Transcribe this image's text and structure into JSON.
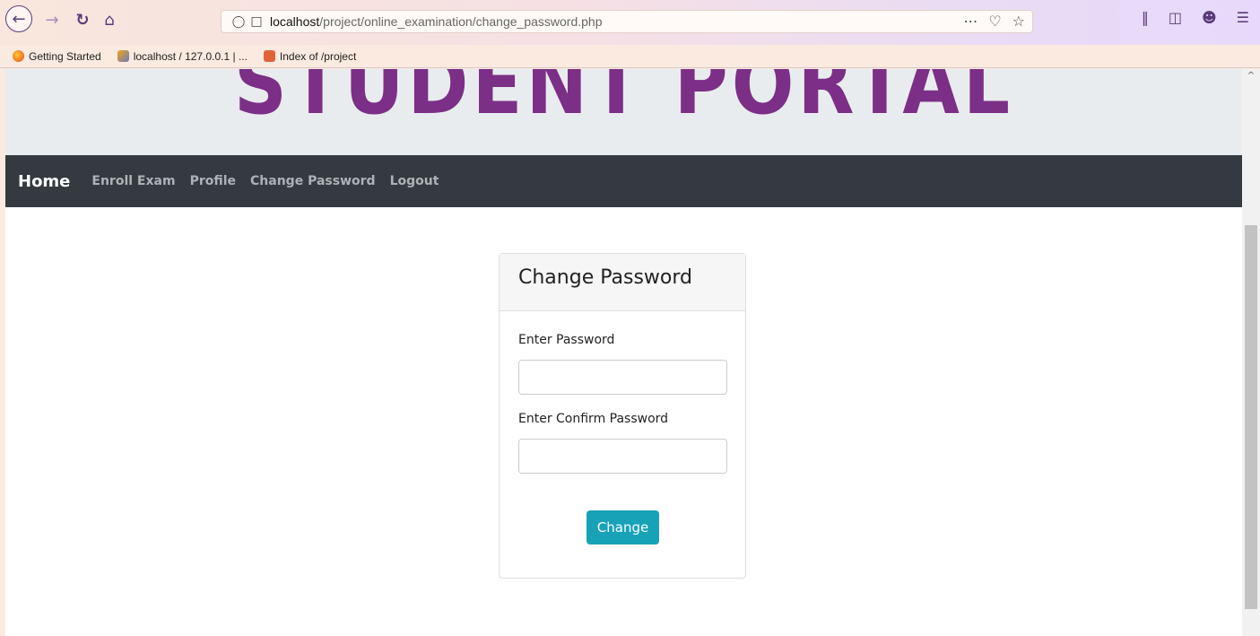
{
  "browser": {
    "url_host": "localhost",
    "url_path": "/project/online_examination/change_password.php",
    "bookmarks": [
      {
        "label": "Getting Started"
      },
      {
        "label": "localhost / 127.0.0.1 | ..."
      },
      {
        "label": "Index of /project"
      }
    ]
  },
  "banner": {
    "title": "STUDENT PORTAL"
  },
  "navbar": {
    "brand": "Home",
    "links": [
      "Enroll Exam",
      "Profile",
      "Change Password",
      "Logout"
    ]
  },
  "form": {
    "title": "Change Password",
    "password_label": "Enter Password",
    "password_value": "",
    "confirm_label": "Enter Confirm Password",
    "confirm_value": "",
    "submit_label": "Change"
  },
  "colors": {
    "banner_text": "#7c2f86",
    "navbar_bg": "#343a40",
    "button_bg": "#17a2b8"
  }
}
